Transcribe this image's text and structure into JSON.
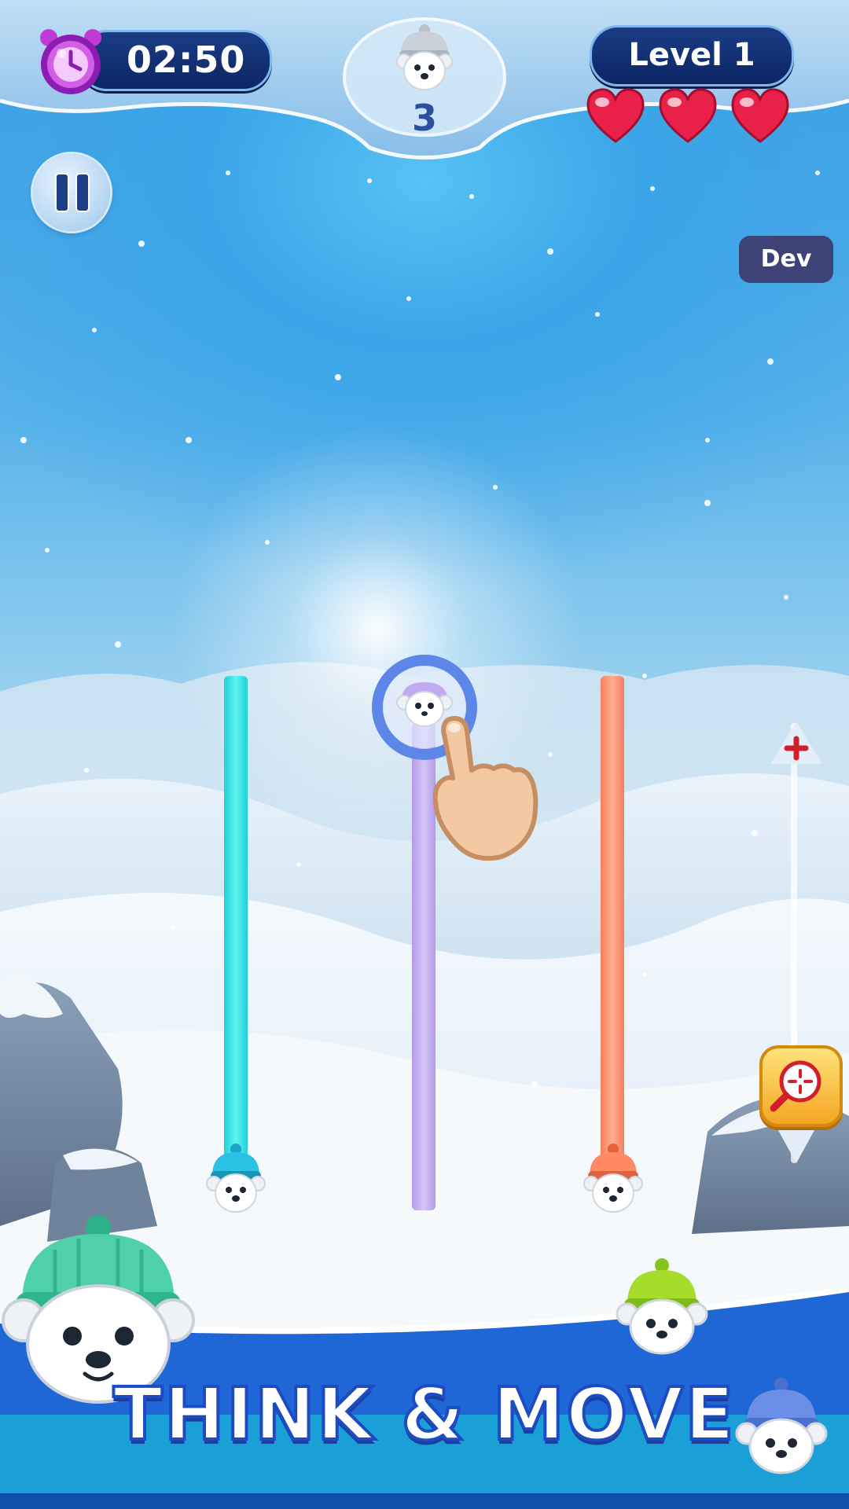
{
  "hud": {
    "timer": "02:50",
    "goal_count": "3",
    "level": "Level 1",
    "lives": 3
  },
  "buttons": {
    "dev_label": "Dev",
    "zoom_plus_label": "+",
    "zoom_minus_label": "−"
  },
  "ropes": [
    {
      "color": "#2fe3e6",
      "bear_hat": "cyan"
    },
    {
      "color": "#c6b3f2",
      "bear_hat": "lavender"
    },
    {
      "color": "#ff9572",
      "bear_hat": "orange"
    }
  ],
  "banner": {
    "slogan": "THINK & MOVE"
  },
  "colors": {
    "hud_pill": "#0c2663",
    "heart": "#e8204a",
    "banner": "#1f66d6"
  },
  "icons": [
    "alarm-clock-icon",
    "polar-bear-icon",
    "heart-icon",
    "pause-icon",
    "tap-hand-icon",
    "zoom-target-icon",
    "plus-icon",
    "minus-icon"
  ]
}
